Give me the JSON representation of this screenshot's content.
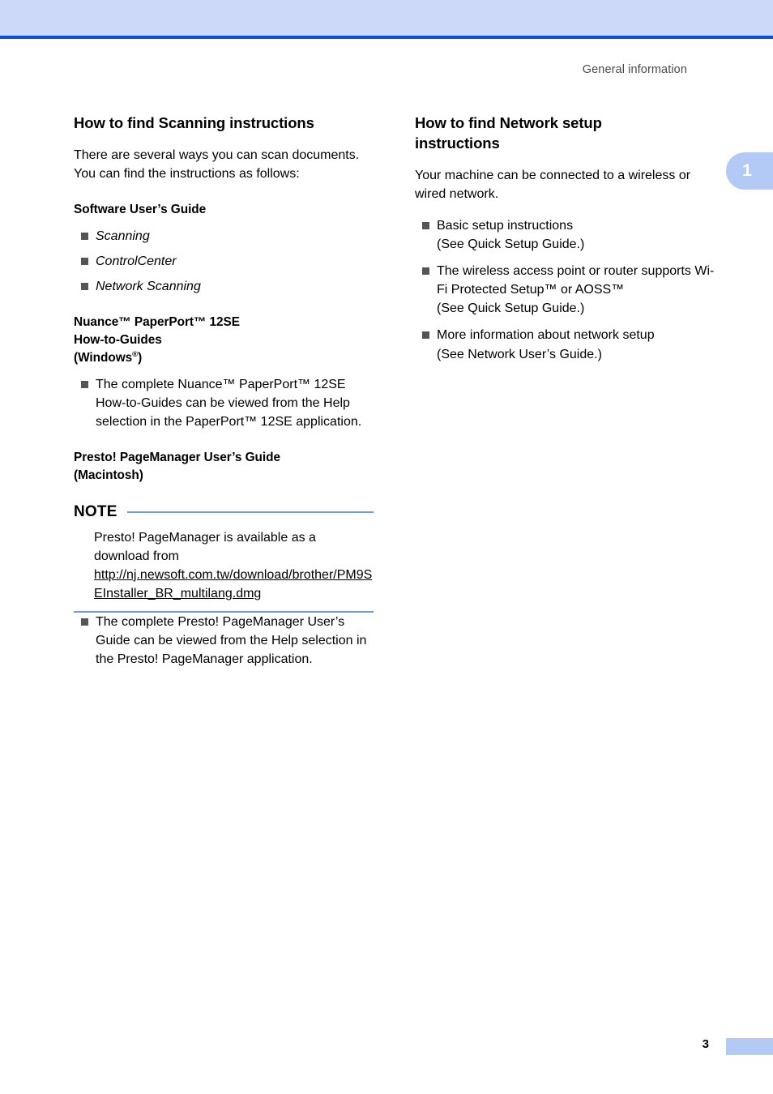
{
  "header": {
    "running_head": "General information",
    "band_color": "#ccd9f9",
    "rule_color": "#0a4ee4"
  },
  "chapter_tab": {
    "number": "1",
    "color": "#b4caf6"
  },
  "left_column": {
    "section_title": "How to find Scanning instructions",
    "intro": "There are several ways you can scan documents. You can find the instructions as follows:",
    "software_guide": {
      "heading": "Software User’s Guide",
      "items": [
        "Scanning",
        "ControlCenter",
        "Network Scanning"
      ]
    },
    "paperport": {
      "heading_line1": "Nuance™ PaperPort™ 12SE",
      "heading_line2": "How-to-Guides",
      "heading_line3_pre": "(Windows",
      "heading_line3_sup": "®",
      "heading_line3_post": ")",
      "items": [
        "The complete Nuance™ PaperPort™ 12SE How-to-Guides can be viewed from the Help selection in the PaperPort™ 12SE application."
      ]
    },
    "pagemanager": {
      "heading_line1": "Presto! PageManager User’s Guide",
      "heading_line2": "(Macintosh)",
      "items": [
        "The complete Presto! PageManager User’s Guide can be viewed from the Help selection in the Presto! PageManager application."
      ]
    },
    "note": {
      "label": "NOTE",
      "text": "Presto! PageManager is available as a download from",
      "url": "http://nj.newsoft.com.tw/download/brother/PM9SEInstaller_BR_multilang.dmg",
      "rule_color": "#6d9ae8"
    }
  },
  "right_column": {
    "section_title_line1": "How to find Network setup",
    "section_title_line2": "instructions",
    "intro": "Your machine can be connected to a wireless or wired network.",
    "items": [
      "Basic setup instructions\n(See Quick Setup Guide.)",
      "The wireless access point or router supports Wi-Fi Protected Setup™ or AOSS™\n(See Quick Setup Guide.)",
      "More information about network setup\n(See Network User’s Guide.)"
    ]
  },
  "footer": {
    "page_number": "3",
    "bar_color": "#b4caf6"
  }
}
